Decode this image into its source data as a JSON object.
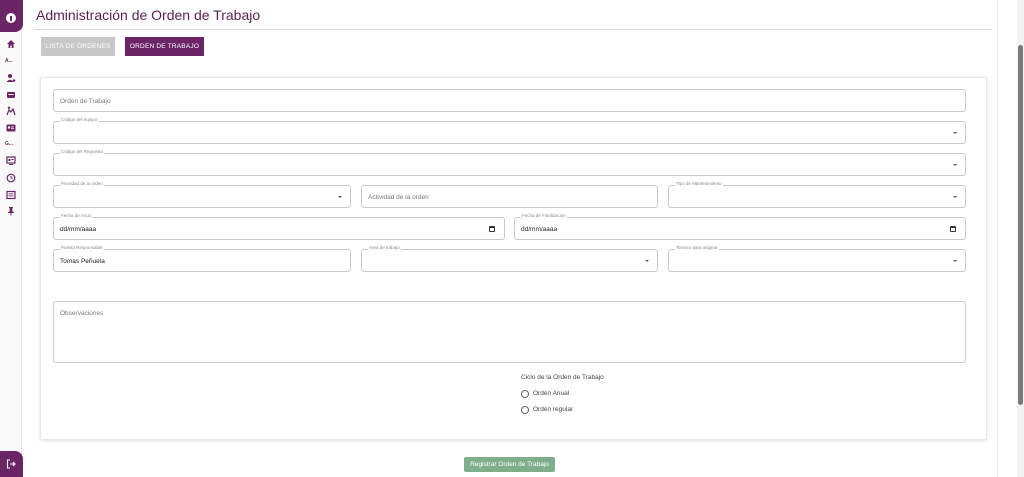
{
  "sidebar": {
    "items": [
      {
        "icon": "home-icon"
      },
      {
        "text": "A..."
      },
      {
        "icon": "user-settings-icon"
      },
      {
        "icon": "badge-icon"
      },
      {
        "icon": "accessibility-icon"
      },
      {
        "icon": "id-card-icon"
      },
      {
        "text": "G..."
      },
      {
        "icon": "dashboard-icon"
      },
      {
        "icon": "history-icon"
      },
      {
        "icon": "list-icon"
      },
      {
        "icon": "pin-icon"
      }
    ],
    "logout_icon": "logout-icon",
    "accent": "#6b2466"
  },
  "header": {
    "title": "Administración de Orden de Trabajo"
  },
  "tabs": {
    "list": "LISTA DE ÓRDENES",
    "order": "ORDEN DE TRABAJO"
  },
  "form": {
    "orden_trabajo_placeholder": "Orden de Trabajo",
    "codigo_equipo_label": "Código del equipo",
    "codigo_repuesto_label": "Código del Repuesto",
    "prioridad_label": "Prioridad de la orden",
    "actividad_placeholder": "Actividad de la orden",
    "tipo_mantenimiento_label": "Tipo de Mantenimiento",
    "fecha_inicio_label": "Fecha de inicio",
    "fecha_inicio_value": "dd/mm/aaaa",
    "fecha_fin_label": "Fecha de Finalizacion",
    "fecha_fin_value": "dd/mm/aaaa",
    "puesto_label": "Puesto Responsable",
    "puesto_value": "Tomas Peñuela",
    "area_label": "Area de trabajo",
    "tecnico_label": "Tecnico para asignar",
    "observaciones_placeholder": "Observaciones",
    "ciclo_title": "Ciclo de la Orden de Trabajo",
    "ciclo_options": [
      "Orden Anual",
      "Orden regular"
    ],
    "submit_label": "Registrar Orden de Trabajo"
  },
  "colors": {
    "primary": "#6b2466",
    "tab_inactive": "#c8c8c8",
    "submit": "#7fae8a"
  }
}
